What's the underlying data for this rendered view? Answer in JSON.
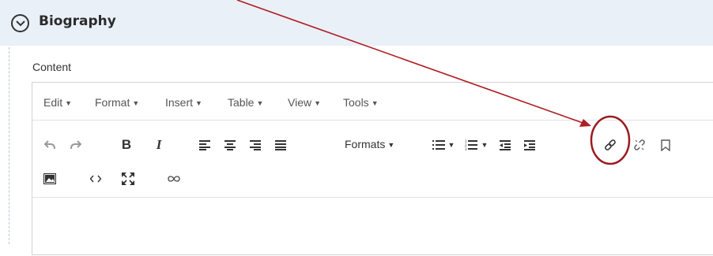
{
  "section": {
    "title": "Biography",
    "content_label": "Content"
  },
  "menubar": {
    "items": [
      {
        "label": "Edit"
      },
      {
        "label": "Format"
      },
      {
        "label": "Insert"
      },
      {
        "label": "Table"
      },
      {
        "label": "View"
      },
      {
        "label": "Tools"
      }
    ]
  },
  "toolbar": {
    "formats_label": "Formats",
    "bold_label": "B",
    "italic_label": "I",
    "icons": [
      "undo-icon",
      "redo-icon",
      "bold-icon",
      "italic-icon",
      "align-left-icon",
      "align-center-icon",
      "align-right-icon",
      "align-justify-icon",
      "bullet-list-icon",
      "numbered-list-icon",
      "outdent-icon",
      "indent-icon",
      "link-icon",
      "unlink-icon",
      "bookmark-icon",
      "image-icon",
      "code-icon",
      "fullscreen-icon",
      "infinity-icon"
    ]
  },
  "annotation": {
    "arrow_color": "#b01d23",
    "circle_color": "#9b1b20"
  }
}
